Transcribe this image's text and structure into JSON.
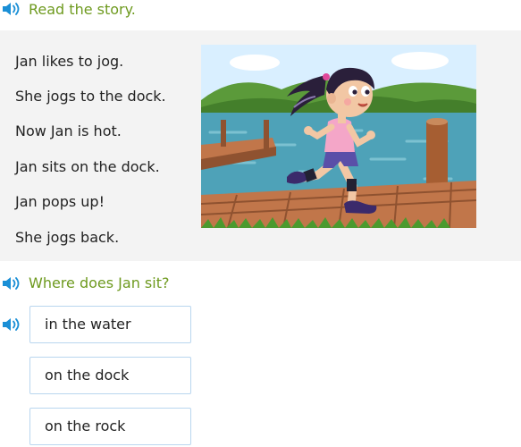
{
  "colors": {
    "instruction_text": "#6e9a1f",
    "speaker_icon": "#1a8fd6",
    "panel_background": "#f3f3f3",
    "choice_border": "#b9d6ef",
    "body_text": "#222222"
  },
  "story_instruction": {
    "text": "Read the story.",
    "icon": "speaker-icon"
  },
  "story": {
    "lines": [
      "Jan likes to jog.",
      "She jogs to the dock.",
      "Now Jan is hot.",
      "Jan sits on the dock.",
      "Jan pops up!",
      "She jogs back."
    ],
    "image": "girl-jogging-on-dock-illustration"
  },
  "question": {
    "text": "Where does Jan sit?",
    "icon": "speaker-icon"
  },
  "choices": {
    "icon": "speaker-icon",
    "items": [
      "in the water",
      "on the dock",
      "on the rock"
    ]
  }
}
